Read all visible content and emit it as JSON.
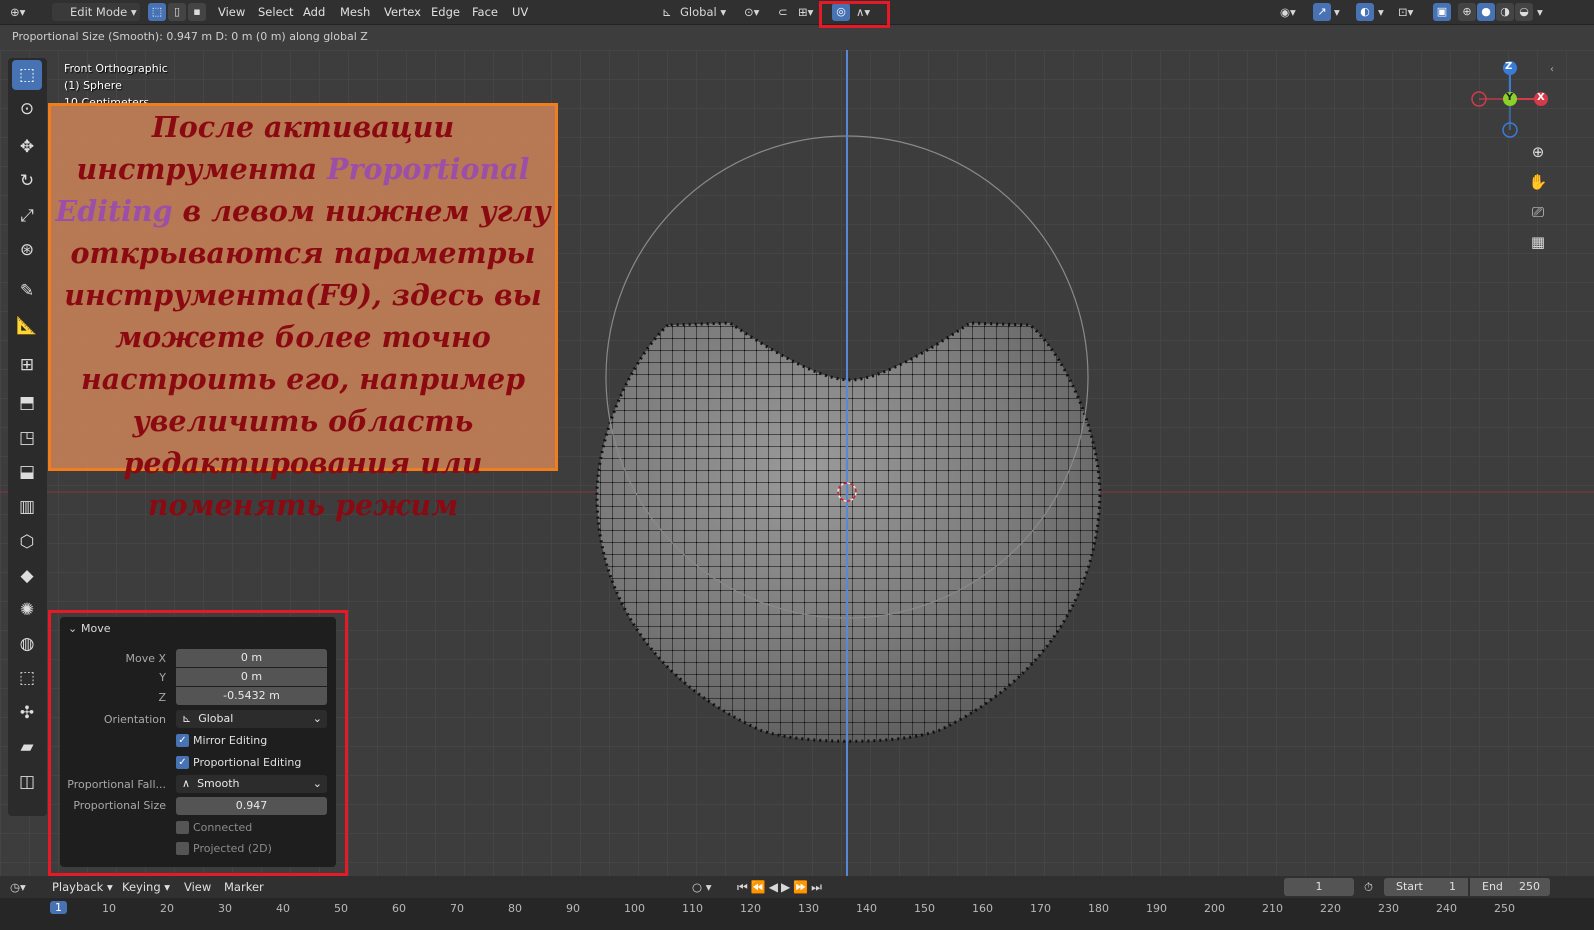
{
  "header": {
    "mode_label": "Edit Mode",
    "menus": [
      "View",
      "Select",
      "Add",
      "Mesh",
      "Vertex",
      "Edge",
      "Face",
      "UV"
    ],
    "orientation_label": "Global"
  },
  "status": {
    "text": "Proportional Size (Smooth): 0.947 m   D: 0 m (0 m) along global Z"
  },
  "viewport": {
    "view_name": "Front Orthographic",
    "object_name": "(1) Sphere",
    "scale_label": "10 Centimeters"
  },
  "annotation": {
    "before_highlight": "После активации инструмента",
    "highlight": "Proportional Editing",
    "after_highlight": "в левом нижнем углу открываются параметры инструмента(F9), здесь вы можете более точно настроить его, например увеличить область редактирования или поменять режим"
  },
  "gizmo": {
    "z": "Z",
    "y": "Y",
    "x": "X"
  },
  "panel": {
    "title": "Move",
    "move_x_label": "Move X",
    "move_x_value": "0 m",
    "y_label": "Y",
    "y_value": "0 m",
    "z_label": "Z",
    "z_value": "-0.5432 m",
    "orientation_label": "Orientation",
    "orientation_value": "Global",
    "mirror_label": "Mirror Editing",
    "prop_edit_label": "Proportional Editing",
    "falloff_label": "Proportional Fall...",
    "falloff_value": "Smooth",
    "size_label": "Proportional Size",
    "size_value": "0.947",
    "connected_label": "Connected",
    "projected_label": "Projected (2D)"
  },
  "timeline": {
    "playback": "Playback",
    "keying": "Keying",
    "view": "View",
    "marker": "Marker",
    "current_frame": "1",
    "start_label": "Start",
    "start_value": "1",
    "end_label": "End",
    "end_value": "250",
    "ticks": [
      "1",
      "10",
      "20",
      "30",
      "40",
      "50",
      "60",
      "70",
      "80",
      "90",
      "100",
      "110",
      "120",
      "130",
      "140",
      "150",
      "160",
      "170",
      "180",
      "190",
      "200",
      "210",
      "220",
      "230",
      "240",
      "250"
    ]
  },
  "colors": {
    "accent": "#4772b3",
    "highlight_red": "#e61a26",
    "annotation_border": "#f07d1e"
  }
}
